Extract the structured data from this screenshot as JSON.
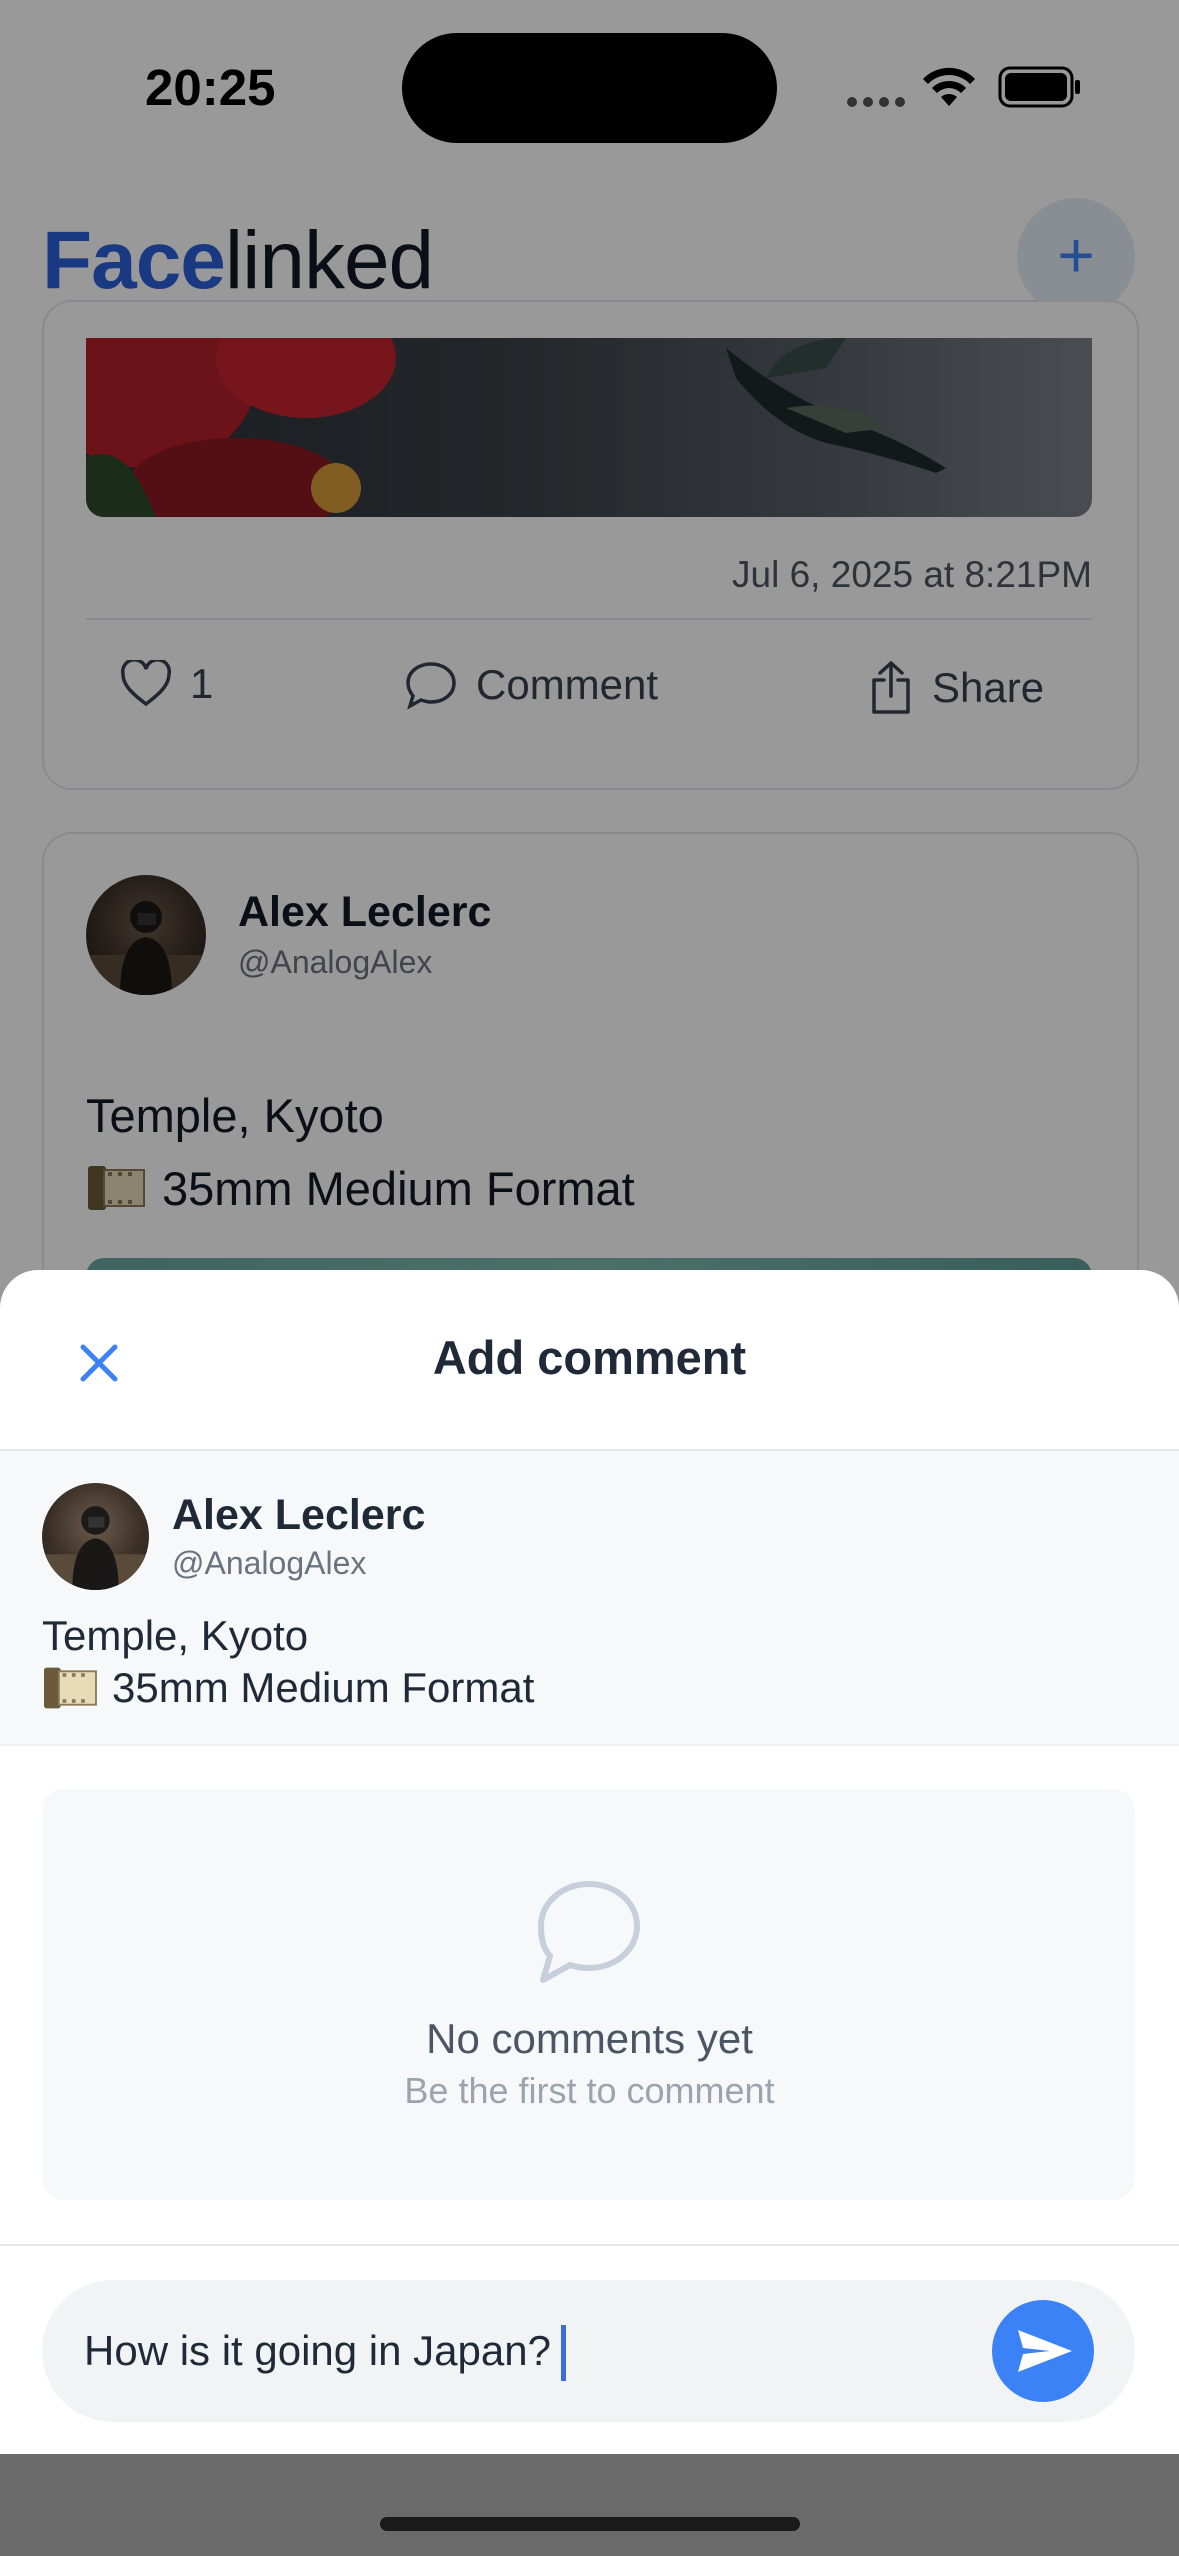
{
  "status_bar": {
    "time": "20:25"
  },
  "app": {
    "brand_part1": "Face",
    "brand_part2": "linked",
    "new_post_icon": "plus-icon"
  },
  "feed": {
    "prev_post": {
      "timestamp": "Jul 6, 2025 at 8:21PM",
      "likes": "1",
      "comment_label": "Comment",
      "share_label": "Share"
    },
    "post": {
      "author_name": "Alex Leclerc",
      "author_handle": "@AnalogAlex",
      "title": "Temple, Kyoto",
      "subtitle": "35mm Medium Format",
      "subtitle_icon": "film-icon"
    }
  },
  "sheet": {
    "title": "Add comment",
    "close_icon": "close-icon",
    "post_preview": {
      "author_name": "Alex Leclerc",
      "author_handle": "@AnalogAlex",
      "title": "Temple, Kyoto",
      "subtitle": "35mm Medium Format"
    },
    "empty_state": {
      "title": "No comments yet",
      "subtitle": "Be the first to comment"
    },
    "input": {
      "value": "How is it going in Japan?"
    },
    "send_icon": "send-icon"
  },
  "colors": {
    "accent": "#3b82f6",
    "brand_blue": "#2b5fd9",
    "overlay": "rgba(0,0,0,0.40)"
  }
}
